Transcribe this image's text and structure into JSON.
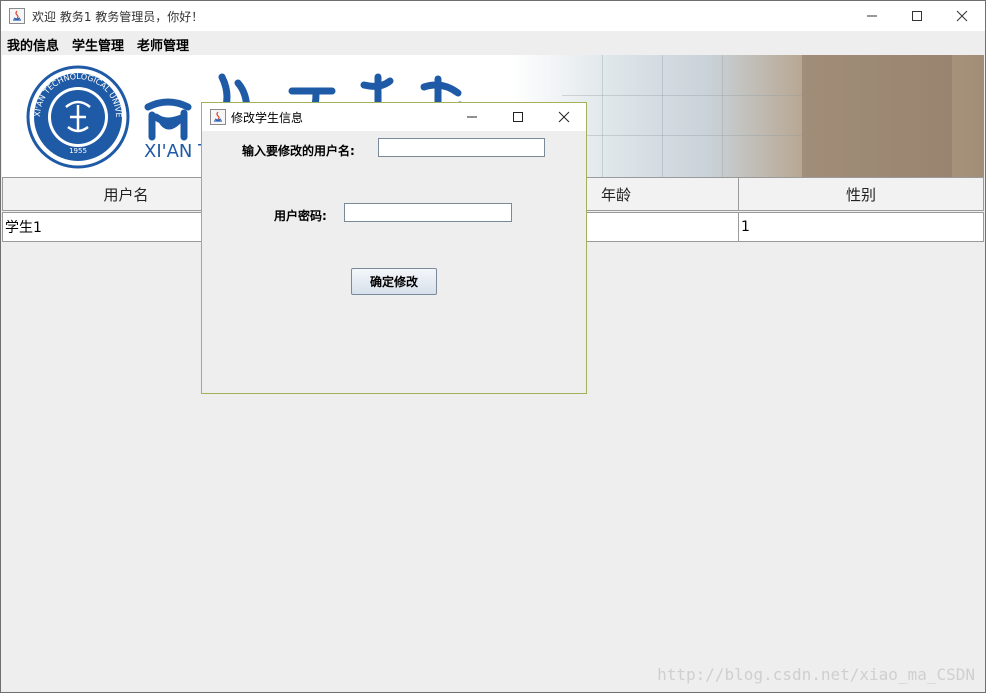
{
  "window": {
    "title": "欢迎 教务1 教务管理员，你好！"
  },
  "menu": {
    "items": [
      "我的信息",
      "学生管理",
      "老师管理"
    ]
  },
  "banner": {
    "seal_text": "XI'AN TECHNOLOGICAL UNIVERSITY",
    "seal_year": "1955",
    "school_name_latin": "XI'AN T"
  },
  "table": {
    "headers": [
      "用户名",
      "年龄",
      "性别"
    ],
    "rows": [
      [
        "学生1",
        "",
        "1"
      ]
    ]
  },
  "dialog": {
    "title": "修改学生信息",
    "username_label": "输入要修改的用户名:",
    "username_value": "",
    "password_label": "用户密码:",
    "password_value": "",
    "confirm_label": "确定修改"
  },
  "watermark": "http://blog.csdn.net/xiao_ma_CSDN",
  "colors": {
    "seal_blue": "#1f5aa6",
    "dialog_border": "#a6b05a"
  }
}
